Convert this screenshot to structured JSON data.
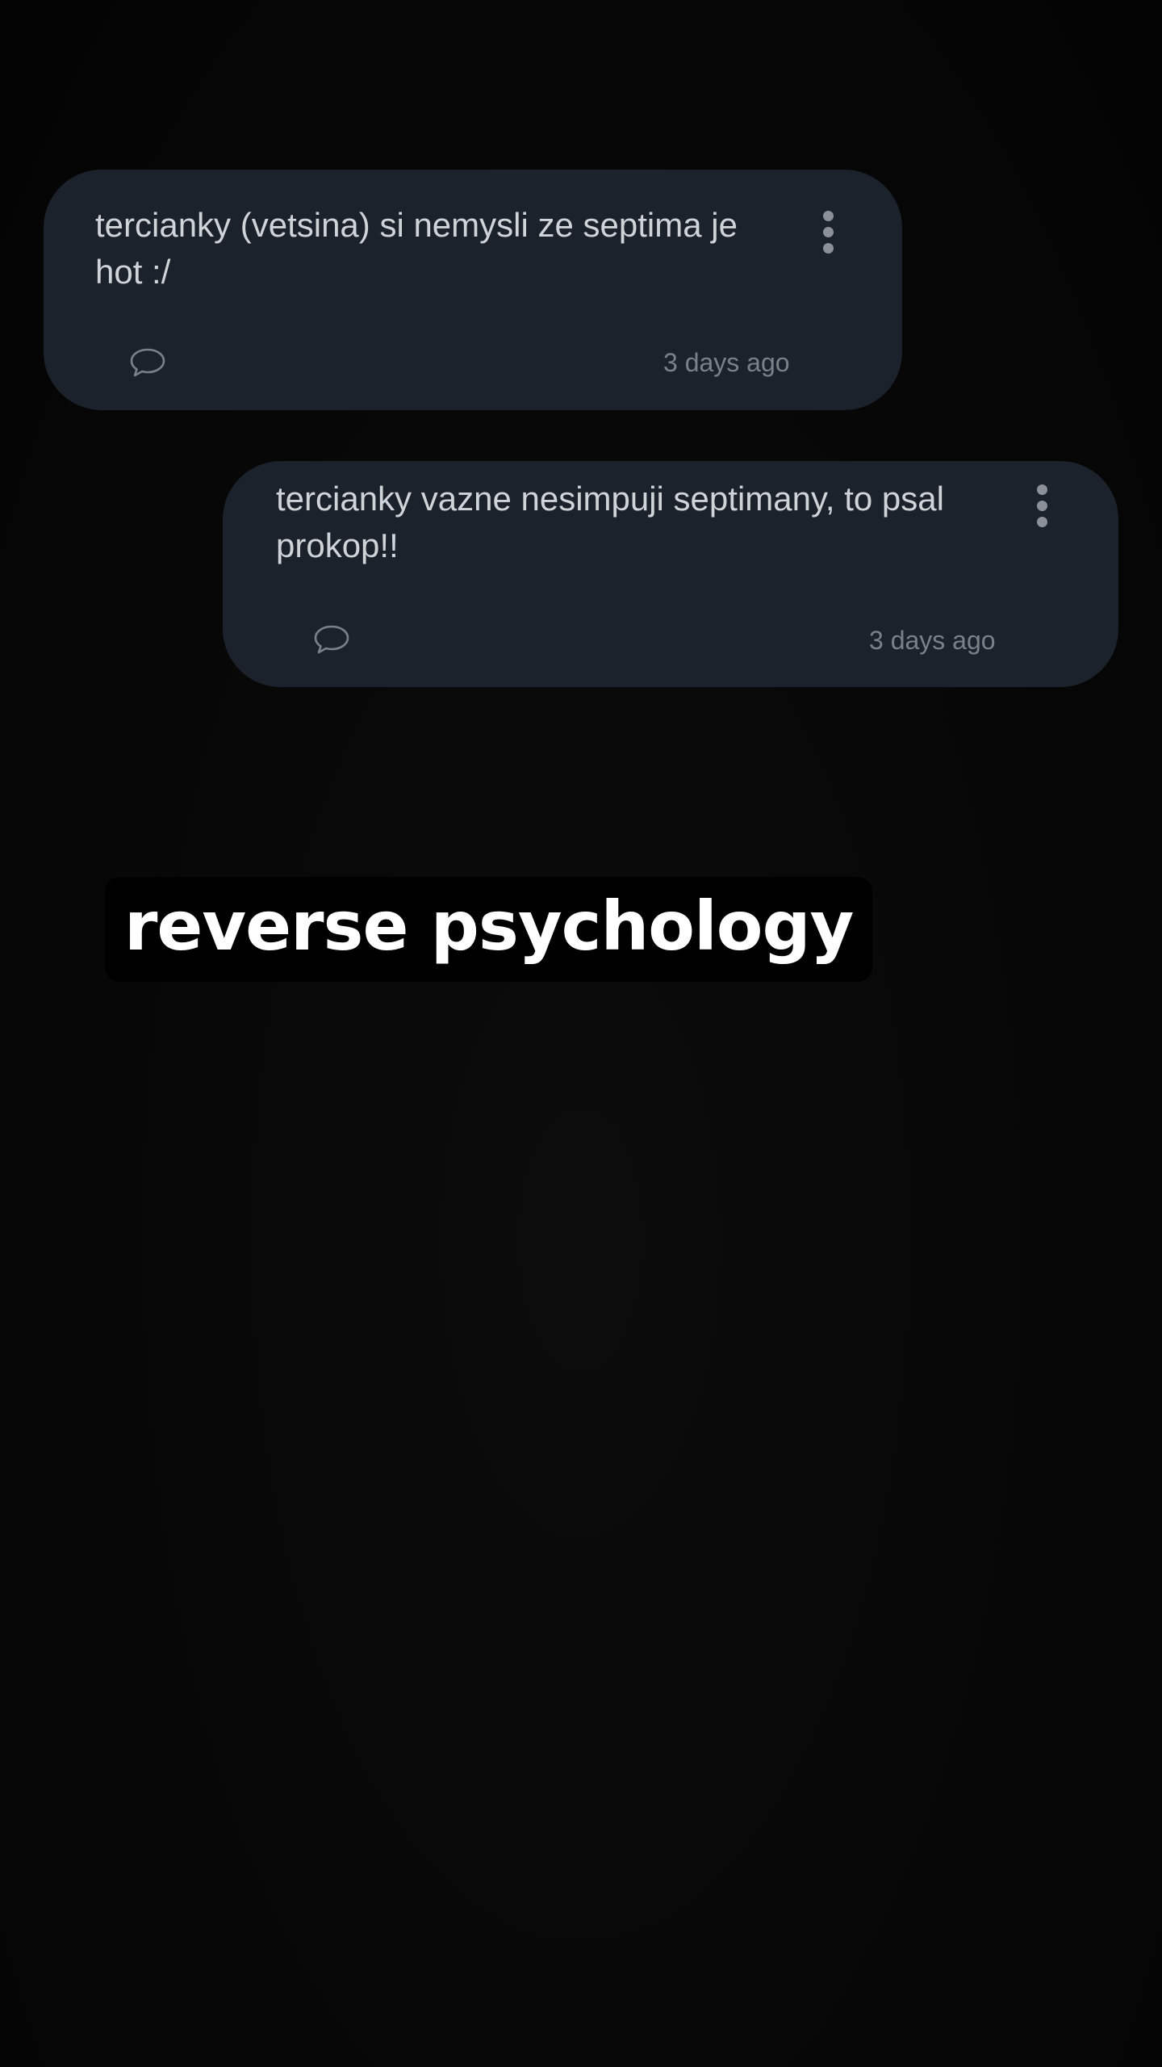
{
  "posts": [
    {
      "text": "tercianky (vetsina) si nemysli ze septima je hot :/",
      "timestamp": "3 days ago",
      "menu_icon": "more-vertical-icon",
      "comment_icon": "comment-bubble-icon"
    },
    {
      "text": "tercianky vazne nesimpuji septimany, to psal prokop!!",
      "timestamp": "3 days ago",
      "menu_icon": "more-vertical-icon",
      "comment_icon": "comment-bubble-icon"
    }
  ],
  "caption": {
    "text": "reverse psychology"
  },
  "colors": {
    "background": "#070707",
    "card": "#1b222b",
    "post_text": "#d0d4d9",
    "timestamp": "#7b8188",
    "caption_bg": "#000000",
    "caption_text": "#ffffff"
  }
}
